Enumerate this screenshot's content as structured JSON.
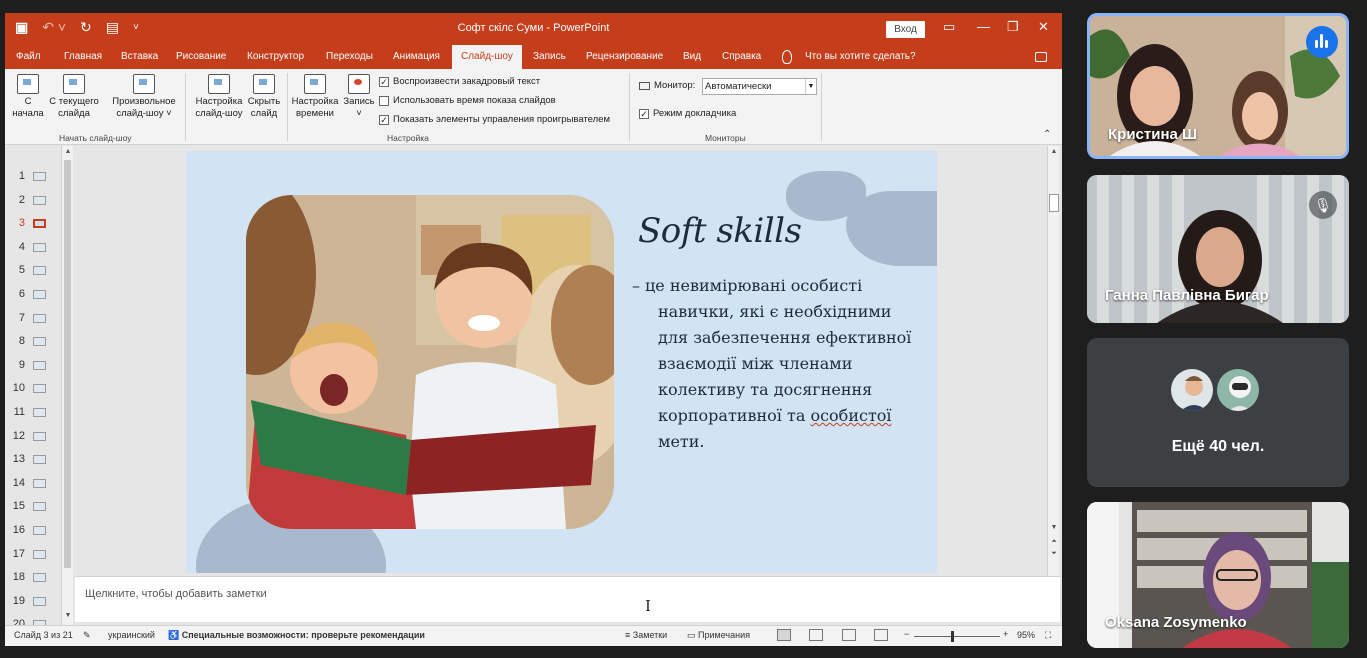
{
  "app": {
    "doc_title": "Софт скілс Суми  -  PowerPoint",
    "signin_label": "Вход"
  },
  "tabs": [
    {
      "label": "Файл"
    },
    {
      "label": "Главная"
    },
    {
      "label": "Вставка"
    },
    {
      "label": "Рисование"
    },
    {
      "label": "Конструктор"
    },
    {
      "label": "Переходы"
    },
    {
      "label": "Анимация"
    },
    {
      "label": "Слайд-шоу",
      "active": true
    },
    {
      "label": "Запись"
    },
    {
      "label": "Рецензирование"
    },
    {
      "label": "Вид"
    },
    {
      "label": "Справка"
    },
    {
      "label": "Что вы хотите сделать?"
    }
  ],
  "ribbon": {
    "from_start_l1": "С",
    "from_start_l2": "начала",
    "from_current_l1": "С текущего",
    "from_current_l2": "слайда",
    "custom_l1": "Произвольное",
    "custom_l2": "слайд-шоу ˅",
    "group_start": "Начать слайд-шоу",
    "setup_l1": "Настройка",
    "setup_l2": "слайд-шоу",
    "hide_l1": "Скрыть",
    "hide_l2": "слайд",
    "timing_l1": "Настройка",
    "timing_l2": "времени",
    "record_l1": "Запись",
    "record_l2": "˅",
    "chk_narration": "Воспроизвести закадровый текст",
    "chk_timings": "Использовать время показа слайдов",
    "chk_controls": "Показать элементы управления проигрывателем",
    "group_setup": "Настройка",
    "monitor_label": "Монитор:",
    "monitor_value": "Автоматически",
    "presenter_view": "Режим докладчика",
    "group_monitors": "Мониторы"
  },
  "thumbnails": [
    "1",
    "2",
    "3",
    "4",
    "5",
    "6",
    "7",
    "8",
    "9",
    "10",
    "11",
    "12",
    "13",
    "14",
    "15",
    "16",
    "17",
    "18",
    "19",
    "20"
  ],
  "current_slide": "3",
  "slide": {
    "title": "Soft skills",
    "dash": "–",
    "lines": [
      "це невимірювані особисті",
      "навички, які є необхідними",
      "для забезпечення ефективної",
      "взаємодії між членами",
      "колективу та досягнення",
      "корпоративної та "
    ],
    "underlined_word": "особистої",
    "last_line": "мети."
  },
  "notes": {
    "placeholder": "Щелкните, чтобы добавить заметки"
  },
  "status": {
    "slide_count": "Слайд 3 из 21",
    "language": "украинский",
    "accessibility_bold": "Специальные возможности: проверьте рекомендации",
    "notes_btn": "Заметки",
    "comments_btn": "Примечания",
    "zoom": "95%"
  },
  "participants": [
    {
      "name": "Кристина Ш",
      "speaking": true
    },
    {
      "name": "Ганна Павлівна Бигар",
      "muted": true
    },
    {
      "name": "Ещё 40 чел."
    },
    {
      "name": "Oksana Zosymenko"
    }
  ],
  "colors": {
    "ppt_accent": "#c43e1c",
    "slide_bg": "#d2e4f3",
    "meet_active_border": "#8ab4f8",
    "meet_tile_bg": "#3c4043"
  }
}
